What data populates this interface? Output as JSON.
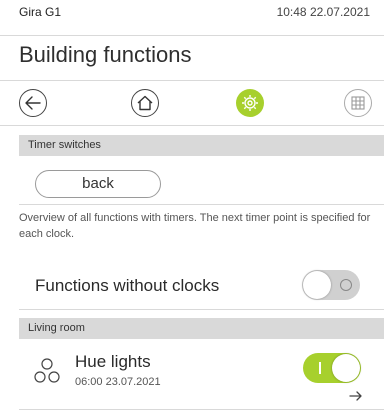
{
  "statusbar": {
    "device": "Gira G1",
    "time": "10:48 22.07.2021"
  },
  "page_title": "Building functions",
  "nav": {
    "icons": [
      "back-arrow-icon",
      "home-icon",
      "gear-icon",
      "grid-icon"
    ],
    "active_color": "#a7d02d"
  },
  "timer_section": {
    "title": "Timer switches",
    "back_label": "back",
    "description": "Overview of all functions with timers. The next timer point is specified for each clock."
  },
  "functions_without_clocks": {
    "label": "Functions without clocks",
    "state": "off"
  },
  "living_room": {
    "title": "Living room",
    "items": [
      {
        "name": "Hue lights",
        "next_timer": "06:00 23.07.2021",
        "state": "on",
        "icon": "hue-lights-icon"
      }
    ]
  },
  "colors": {
    "accent": "#a7d02d",
    "section_bg": "#d9d9d9"
  }
}
